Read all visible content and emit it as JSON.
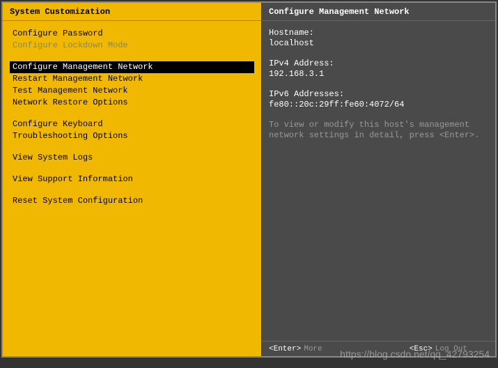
{
  "left": {
    "title": "System Customization",
    "groups": [
      [
        {
          "label": "Configure Password",
          "disabled": false,
          "selected": false
        },
        {
          "label": "Configure Lockdown Mode",
          "disabled": true,
          "selected": false
        }
      ],
      [
        {
          "label": "Configure Management Network",
          "disabled": false,
          "selected": true
        },
        {
          "label": "Restart Management Network",
          "disabled": false,
          "selected": false
        },
        {
          "label": "Test Management Network",
          "disabled": false,
          "selected": false
        },
        {
          "label": "Network Restore Options",
          "disabled": false,
          "selected": false
        }
      ],
      [
        {
          "label": "Configure Keyboard",
          "disabled": false,
          "selected": false
        },
        {
          "label": "Troubleshooting Options",
          "disabled": false,
          "selected": false
        }
      ],
      [
        {
          "label": "View System Logs",
          "disabled": false,
          "selected": false
        }
      ],
      [
        {
          "label": "View Support Information",
          "disabled": false,
          "selected": false
        }
      ],
      [
        {
          "label": "Reset System Configuration",
          "disabled": false,
          "selected": false
        }
      ]
    ]
  },
  "right": {
    "title": "Configure Management Network",
    "hostname_label": "Hostname:",
    "hostname_value": "localhost",
    "ipv4_label": "IPv4 Address:",
    "ipv4_value": "192.168.3.1",
    "ipv6_label": "IPv6 Addresses:",
    "ipv6_value": "fe80::20c:29ff:fe60:4072/64",
    "hint": "To view or modify this host's management network settings in detail, press <Enter>."
  },
  "footer": {
    "enter_key": "<Enter>",
    "enter_label": "More",
    "esc_key": "<Esc>",
    "esc_label": "Log Out"
  },
  "watermark": "https://blog.csdn.net/qq_42793254"
}
